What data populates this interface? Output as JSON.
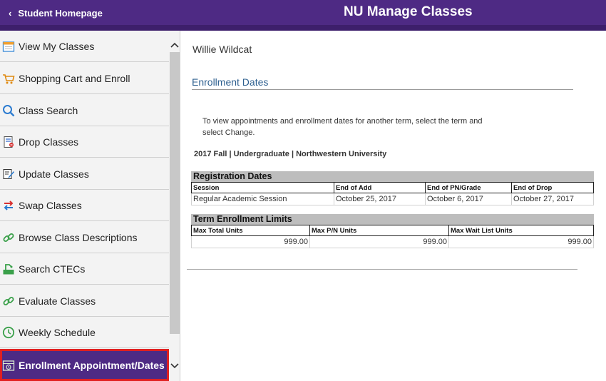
{
  "header": {
    "back_label": "Student Homepage",
    "title": "NU Manage Classes"
  },
  "sidebar": {
    "items": [
      {
        "label": "View My Classes",
        "icon": "calendar-icon"
      },
      {
        "label": "Shopping Cart and Enroll",
        "icon": "shopping-cart-icon"
      },
      {
        "label": "Class Search",
        "icon": "search-icon"
      },
      {
        "label": "Drop Classes",
        "icon": "drop-list-icon"
      },
      {
        "label": "Update Classes",
        "icon": "edit-icon"
      },
      {
        "label": "Swap Classes",
        "icon": "swap-arrows-icon"
      },
      {
        "label": "Browse Class Descriptions",
        "icon": "link-icon"
      },
      {
        "label": "Search CTECs",
        "icon": "ctec-icon"
      },
      {
        "label": "Evaluate Classes",
        "icon": "link-icon"
      },
      {
        "label": "Weekly Schedule",
        "icon": "clock-icon"
      },
      {
        "label": "Enrollment Appointment/Dates",
        "icon": "appointment-calendar-icon"
      }
    ]
  },
  "main": {
    "student_name": "Willie Wildcat",
    "section_title": "Enrollment Dates",
    "instructions": "To view appointments and enrollment dates for another term, select the term and select Change.",
    "term": "2017 Fall | Undergraduate | Northwestern University",
    "registration": {
      "caption": "Registration Dates",
      "headers": [
        "Session",
        "End of Add",
        "End of PN/Grade",
        "End of Drop"
      ],
      "rows": [
        [
          "Regular Academic Session",
          "October 25, 2017",
          "October 6, 2017",
          "October 27, 2017"
        ]
      ]
    },
    "limits": {
      "caption": "Term Enrollment Limits",
      "headers": [
        "Max Total Units",
        "Max P/N Units",
        "Max Wait List Units"
      ],
      "rows": [
        [
          "999.00",
          "999.00",
          "999.00"
        ]
      ]
    }
  },
  "colors": {
    "brand_purple": "#4e2a84",
    "active_border": "#e02020",
    "link_blue": "#2d5f8f"
  }
}
